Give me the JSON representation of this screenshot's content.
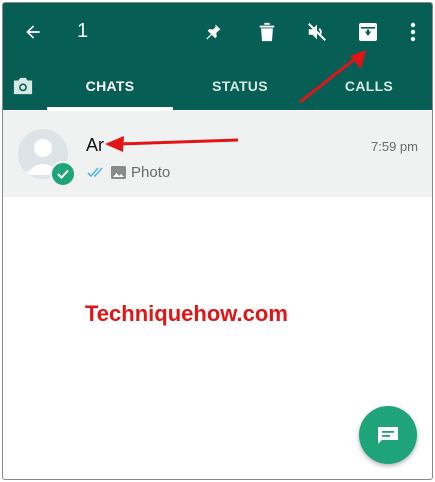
{
  "toolbar": {
    "selected_count": "1",
    "icons": [
      "back-arrow-icon",
      "pin-icon",
      "delete-icon",
      "mute-icon",
      "archive-icon",
      "more-vert-icon"
    ]
  },
  "tabs": {
    "camera_icon": "camera-icon",
    "items": [
      {
        "label": "CHATS",
        "active": true
      },
      {
        "label": "STATUS",
        "active": false
      },
      {
        "label": "CALLS",
        "active": false
      }
    ]
  },
  "chat": {
    "name": "Ar",
    "time": "7:59 pm",
    "preview": "Photo",
    "selected": true
  },
  "watermark": "Techniquehow.com",
  "colors": {
    "header": "#075e54",
    "accent": "#1fa47a",
    "annotation_arrow": "#e11515",
    "selected_row": "#f0f2f2"
  }
}
